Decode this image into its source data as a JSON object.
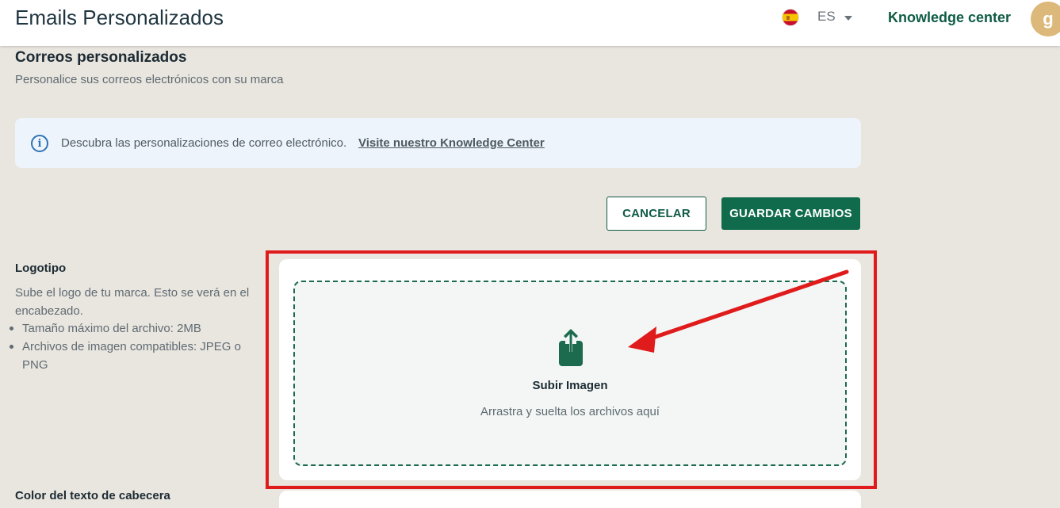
{
  "header": {
    "title": "Emails Personalizados",
    "language": "ES",
    "knowledge_center": "Knowledge center",
    "avatar_letter": "g"
  },
  "page": {
    "title": "Correos personalizados",
    "subtitle": "Personalice sus correos electrónicos con su marca"
  },
  "info_banner": {
    "text": "Descubra las personalizaciones de correo electrónico.",
    "link": "Visite nuestro Knowledge Center"
  },
  "actions": {
    "cancel_label": "CANCELAR",
    "save_label": "GUARDAR CAMBIOS"
  },
  "logo_section": {
    "title": "Logotipo",
    "description": "Sube el logo de tu marca. Esto se verá en el encabezado.",
    "requirements": [
      "Tamaño máximo del archivo: 2MB",
      "Archivos de imagen compatibles: JPEG o PNG"
    ]
  },
  "upload": {
    "title": "Subir Imagen",
    "hint": "Arrastra y suelta los archivos aquí",
    "icon": "upload-icon"
  },
  "next_section": {
    "title": "Color del texto de cabecera"
  },
  "colors": {
    "brand_green": "#0f6b4c",
    "annotation_red": "#e01b1b",
    "page_background": "#e9e5df",
    "info_blue": "#2e73b5"
  }
}
